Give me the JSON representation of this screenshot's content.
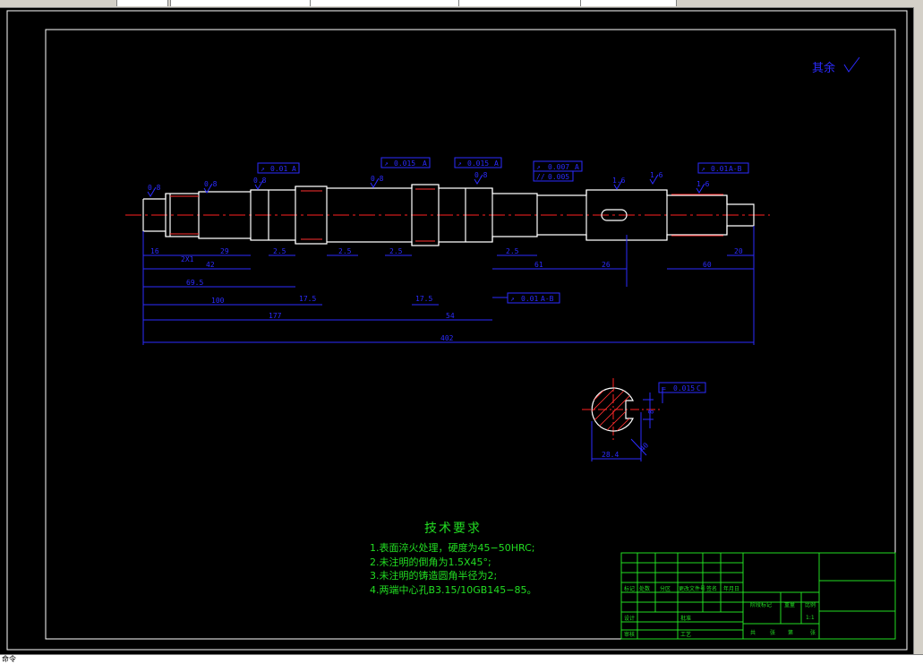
{
  "window": {
    "tabs": [
      "",
      "",
      "",
      "",
      ""
    ]
  },
  "statusbar": {
    "text": "命令"
  },
  "drawing": {
    "roughness_note": "其余",
    "surface_marks": [
      "0.8",
      "0.8",
      "0.8",
      "0.8",
      "0.8",
      "1.6",
      "1.6",
      "1.6"
    ],
    "tolerance_frames": [
      {
        "symbol": "↗",
        "value": "0.01",
        "datum": "A"
      },
      {
        "symbol": "↗",
        "value": "0.015",
        "datum": "A"
      },
      {
        "symbol": "↗",
        "value": "0.015",
        "datum": "A"
      },
      {
        "symbol": "↗",
        "value": "0.007",
        "datum": "A"
      },
      {
        "symbol": "//",
        "value": "0.005",
        "datum": ""
      },
      {
        "symbol": "↗",
        "value": "0.01",
        "datum": "A-B"
      },
      {
        "symbol": "↗",
        "value": "0.01",
        "datum": "A-B"
      },
      {
        "symbol": "=",
        "value": "0.015",
        "datum": "C"
      }
    ],
    "dims_row1": [
      "16",
      "2X1",
      "29",
      "2.5",
      "2.5",
      "2.5",
      "2.5",
      "61",
      "26",
      "60",
      "20"
    ],
    "dims_row2": [
      "42",
      "69.5",
      "100",
      "17.5",
      "17.5",
      "177",
      "54",
      "402"
    ],
    "section_dims": [
      "28.4",
      "8",
      "40"
    ]
  },
  "tech": {
    "title": "技术要求",
    "lines": [
      "1.表面淬火处理，硬度为45−50HRC;",
      "2.未注明的倒角为1.5X45°;",
      "3.未注明的铸造圆角半径为2;",
      "4.两端中心孔B3.15/10GB145−85。"
    ]
  },
  "title_block": {
    "row_labels": [
      "标记",
      "处数",
      "分区",
      "更改文件号",
      "签名",
      "年月日"
    ],
    "role_labels": [
      "设计",
      "审核",
      "工艺",
      "批准"
    ],
    "stage_label": "阶段标记",
    "weight_label": "重量",
    "scale_label": "比例",
    "scale_value": "1:1",
    "sheet_labels": [
      "共",
      "张",
      "第",
      "张"
    ]
  }
}
